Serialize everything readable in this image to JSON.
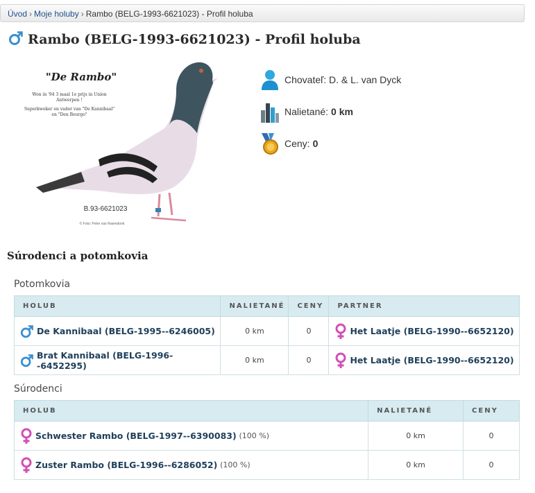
{
  "breadcrumb": {
    "items": [
      "Úvod",
      "Moje holuby"
    ],
    "current": "Rambo (BELG-1993-6621023) - Profil holuba"
  },
  "page": {
    "title": "Rambo (BELG-1993-6621023) - Profil holuba"
  },
  "photo": {
    "caption_title": "\"De Rambo\"",
    "caption_line1": "Won in '94 3 maal 1e prijs in Union",
    "caption_line2": "Antwerpen !",
    "caption_line3": "Superkweker en vader van \"De Kannibaal\"",
    "caption_line4": "en \"Den Bourgo\"",
    "ring": "B.93-6621023",
    "credit": "© Foto: Peter van Raemdonk"
  },
  "info": {
    "breeder_label": "Chovateľ:",
    "breeder_value": "D. & L. van Dyck",
    "distance_label": "Nalietané:",
    "distance_value": "0 km",
    "prizes_label": "Ceny:",
    "prizes_value": "0"
  },
  "section": {
    "title": "Súrodenci a potomkovia"
  },
  "offspring": {
    "title": "Potomkovia",
    "headers": [
      "HOLUB",
      "NALIETANÉ",
      "CENY",
      "PARTNER"
    ],
    "rows": [
      {
        "name": "De Kannibaal (BELG-1995--6246005)",
        "distance": "0 km",
        "prizes": "0",
        "partner": "Het Laatje (BELG-1990--6652120)"
      },
      {
        "name": "Brat Kannibaal (BELG-1996--6452295)",
        "distance": "0 km",
        "prizes": "0",
        "partner": "Het Laatje (BELG-1990--6652120)"
      }
    ]
  },
  "siblings": {
    "title": "Súrodenci",
    "headers": [
      "HOLUB",
      "NALIETANÉ",
      "CENY"
    ],
    "rows": [
      {
        "name": "Schwester Rambo (BELG-1997--6390083)",
        "pct": "(100 %)",
        "distance": "0 km",
        "prizes": "0"
      },
      {
        "name": "Zuster Rambo (BELG-1996--6286052)",
        "pct": "(100 %)",
        "distance": "0 km",
        "prizes": "0"
      }
    ]
  },
  "colors": {
    "link": "#1e3f5a",
    "header_bg": "#d7ebf0",
    "male": "#3a8fd0",
    "female": "#d14fb6"
  }
}
